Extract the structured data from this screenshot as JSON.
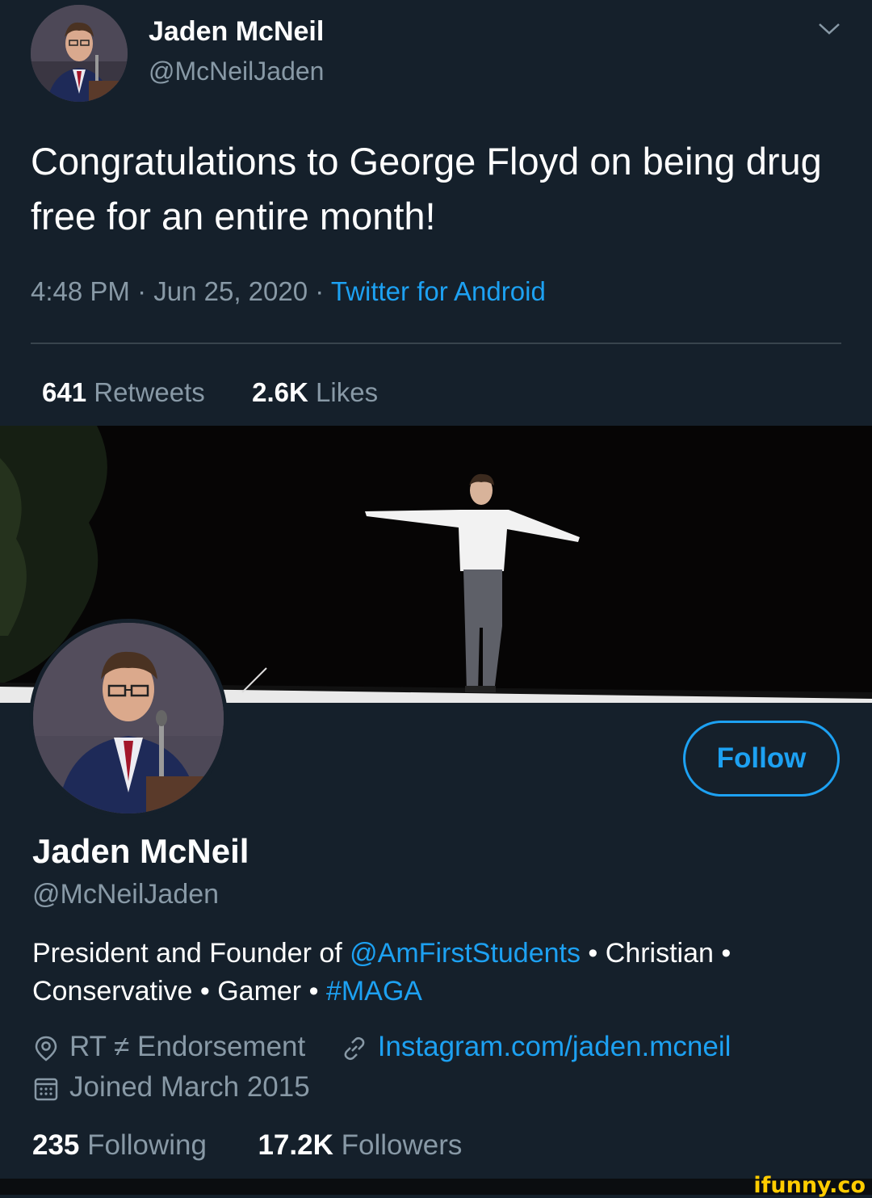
{
  "tweet": {
    "author_name": "Jaden McNeil",
    "author_handle": "@McNeilJaden",
    "text": "Congratulations to George Floyd on being drug free for an entire month!",
    "time": "4:48 PM",
    "sep1": "·",
    "date": "Jun 25, 2020",
    "sep2": "·",
    "source": "Twitter for Android",
    "retweets_count": "641",
    "retweets_label": "Retweets",
    "likes_count": "2.6K",
    "likes_label": "Likes"
  },
  "profile": {
    "name": "Jaden McNeil",
    "handle": "@McNeilJaden",
    "follow_label": "Follow",
    "bio": {
      "part1": "President and Founder of ",
      "mention": "@AmFirstStudents",
      "part2": " • Christian • Conservative • Gamer • ",
      "hashtag": "#MAGA"
    },
    "location": "RT ≠ Endorsement",
    "website": "Instagram.com/jaden.mcneil",
    "joined": "Joined March 2015",
    "following_count": "235",
    "following_label": "Following",
    "followers_count": "17.2K",
    "followers_label": "Followers"
  },
  "watermark": "ifunny.co",
  "colors": {
    "background": "#15202b",
    "link": "#1da1f2",
    "secondary_text": "#8899a6",
    "divider": "#38444d",
    "watermark": "#ffcc00"
  },
  "icons": [
    "chevron-down-icon",
    "location-pin-icon",
    "link-icon",
    "calendar-icon"
  ]
}
